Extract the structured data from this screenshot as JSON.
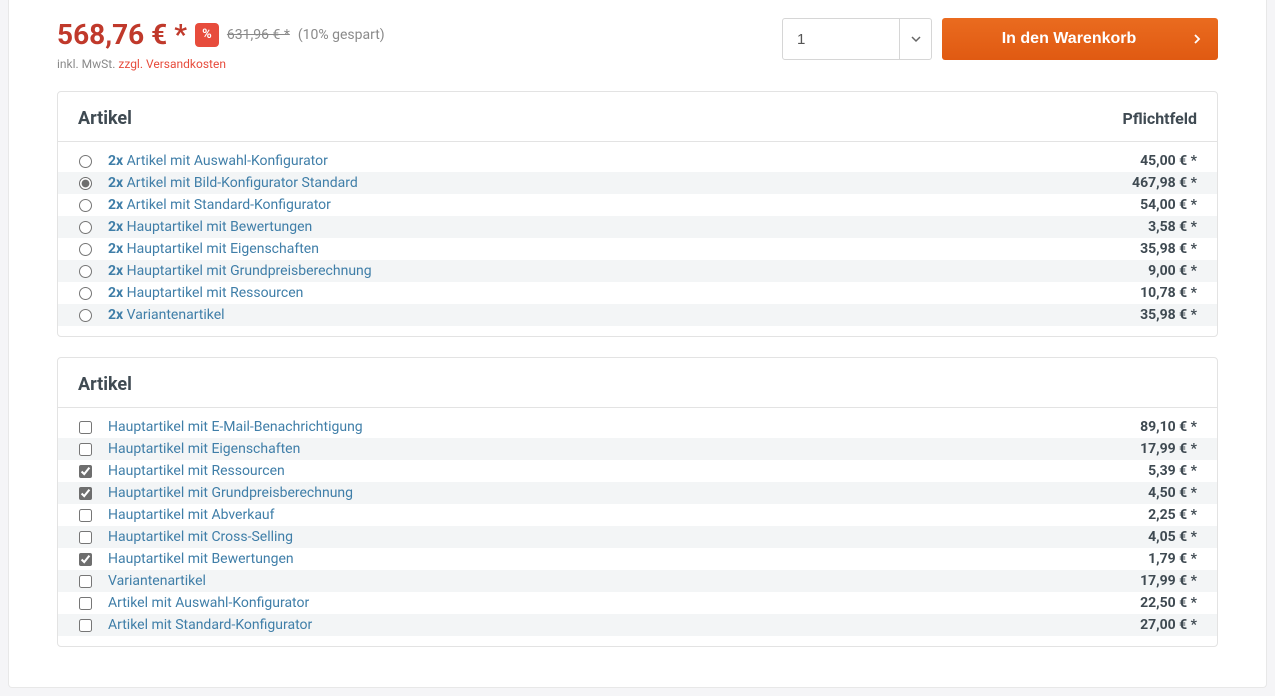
{
  "buybox": {
    "price": "568,76 € *",
    "discount_badge": "%",
    "old_price": "631,96 € *",
    "savings": "(10% gespart)",
    "tax_prefix": "inkl. MwSt. ",
    "shipping_link": "zzgl. Versandkosten",
    "qty_value": "1",
    "add_to_cart": "In den Warenkorb"
  },
  "panel1": {
    "title": "Artikel",
    "required_label": "Pflichtfeld",
    "items": [
      {
        "qty": "2x",
        "label": "Artikel mit Auswahl-Konfigurator",
        "price": "45,00 € *",
        "selected": false
      },
      {
        "qty": "2x",
        "label": "Artikel mit Bild-Konfigurator Standard",
        "price": "467,98 € *",
        "selected": true
      },
      {
        "qty": "2x",
        "label": "Artikel mit Standard-Konfigurator",
        "price": "54,00 € *",
        "selected": false
      },
      {
        "qty": "2x",
        "label": "Hauptartikel mit Bewertungen",
        "price": "3,58 € *",
        "selected": false
      },
      {
        "qty": "2x",
        "label": "Hauptartikel mit Eigenschaften",
        "price": "35,98 € *",
        "selected": false
      },
      {
        "qty": "2x",
        "label": "Hauptartikel mit Grundpreisberechnung",
        "price": "9,00 € *",
        "selected": false
      },
      {
        "qty": "2x",
        "label": "Hauptartikel mit Ressourcen",
        "price": "10,78 € *",
        "selected": false
      },
      {
        "qty": "2x",
        "label": "Variantenartikel",
        "price": "35,98 € *",
        "selected": false
      }
    ]
  },
  "panel2": {
    "title": "Artikel",
    "items": [
      {
        "label": "Hauptartikel mit E-Mail-Benachrichtigung",
        "price": "89,10 € *",
        "checked": false
      },
      {
        "label": "Hauptartikel mit Eigenschaften",
        "price": "17,99 € *",
        "checked": false
      },
      {
        "label": "Hauptartikel mit Ressourcen",
        "price": "5,39 € *",
        "checked": true
      },
      {
        "label": "Hauptartikel mit Grundpreisberechnung",
        "price": "4,50 € *",
        "checked": true
      },
      {
        "label": "Hauptartikel mit Abverkauf",
        "price": "2,25 € *",
        "checked": false
      },
      {
        "label": "Hauptartikel mit Cross-Selling",
        "price": "4,05 € *",
        "checked": false
      },
      {
        "label": "Hauptartikel mit Bewertungen",
        "price": "1,79 € *",
        "checked": true
      },
      {
        "label": "Variantenartikel",
        "price": "17,99 € *",
        "checked": false
      },
      {
        "label": "Artikel mit Auswahl-Konfigurator",
        "price": "22,50 € *",
        "checked": false
      },
      {
        "label": "Artikel mit Standard-Konfigurator",
        "price": "27,00 € *",
        "checked": false
      }
    ]
  }
}
